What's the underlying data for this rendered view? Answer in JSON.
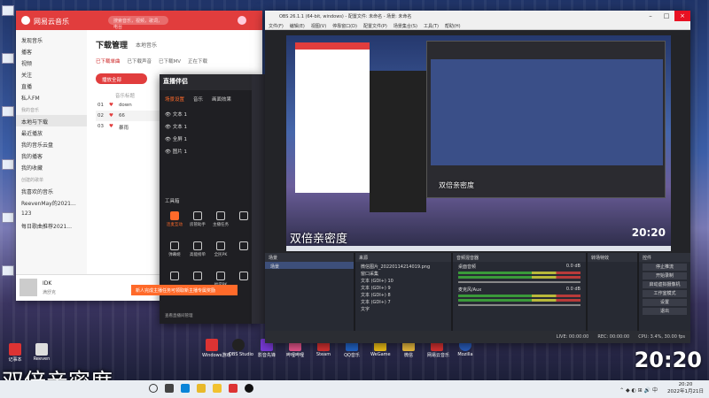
{
  "netease": {
    "app_title": "网易云音乐",
    "search_placeholder": "搜索音乐，视频，歌词，电台",
    "user": "Reeven",
    "sidebar": {
      "items": [
        "发现音乐",
        "播客",
        "视频",
        "关注",
        "直播",
        "私人FM"
      ],
      "group_my": "我的音乐",
      "my_items": [
        "本地与下载",
        "最近播放",
        "我的音乐云盘",
        "我的播客",
        "我的收藏"
      ],
      "group_created": "创建的歌单",
      "playlists": [
        "我喜欢的音乐",
        "ReevenMay的2021...",
        "123",
        "每日歌曲推荐2021..."
      ]
    },
    "main": {
      "title": "下载管理",
      "subtitle": "本地音乐",
      "tabs": [
        "已下载单曲",
        "已下载声音",
        "已下载MV",
        "正在下载"
      ],
      "play_all": "播放全部",
      "col_header": "音乐标题",
      "rows": [
        {
          "no": "01",
          "title": "down"
        },
        {
          "no": "02",
          "title": "66"
        },
        {
          "no": "03",
          "title": "暴雨"
        }
      ]
    },
    "player": {
      "song": "IDK",
      "artist": "满舒克"
    }
  },
  "livehime": {
    "title": "直播伴侣",
    "tabs": [
      "场景设置",
      "音乐",
      "画面效果"
    ],
    "sources": [
      "文本 1",
      "文本 1",
      "全屏 1",
      "图片 1"
    ],
    "toolbox_label": "工具箱",
    "tools": [
      "连麦互动",
      "房管助手",
      "主播任务",
      "",
      "弹幕姬",
      "高能榜单",
      "全民PK",
      "",
      "",
      "",
      "福袋PK",
      "",
      "",
      "",
      "",
      ""
    ],
    "bottom_link": "查看直播间管理",
    "toast": "新人完成主播任务可领取新主播专属奖励"
  },
  "obs": {
    "title": "OBS 26.1.1 (64-bit, windows) - 配置文件: 未命名 - 场景: 未命名",
    "menu": [
      "文件(F)",
      "编辑(E)",
      "视图(V)",
      "停靠窗口(D)",
      "配置文件(P)",
      "场景集合(S)",
      "工具(T)",
      "帮助(H)"
    ],
    "preview_time": "20:20",
    "subtitle_preview": "双倍亲密度",
    "docks": {
      "scenes": "场景",
      "scene_items": [
        "场景"
      ],
      "sources": "来源",
      "source_items": [
        "微信图片_20220114214019.png",
        "窗口采集",
        "文本 (GDI+) 10",
        "文本 (GDI+) 9",
        "文本 (GDI+) 8",
        "文本 (GDI+) 7",
        "文字"
      ],
      "mixer": "音频混音器",
      "mixer_channels": [
        {
          "name": "桌面音频",
          "db": "0.0 dB"
        },
        {
          "name": "麦克风/Aux",
          "db": "0.0 dB"
        }
      ],
      "transitions": "转场特效",
      "controls": "控件",
      "control_buttons": [
        "停止推流",
        "开始录制",
        "启动虚拟摄像机",
        "工作室模式",
        "设置",
        "退出"
      ]
    },
    "status": [
      "LIVE: 00:00:00",
      "REC: 00:00:00",
      "CPU: 3.4%, 30.00 fps"
    ]
  },
  "desktop": {
    "clock": "20:20",
    "subtitle": "双倍亲密度",
    "bottom_icons": [
      "Windows游戏",
      "OBS Studio",
      "影音先锋",
      "哔哩哔哩",
      "Steam",
      "QQ音乐",
      "WeGame",
      "微信",
      "网易云音乐",
      "Mozilla"
    ],
    "left_icons": [
      "记事本",
      "Reeven"
    ]
  },
  "taskbar": {
    "time": "20:20",
    "date": "2022年1月21日"
  }
}
